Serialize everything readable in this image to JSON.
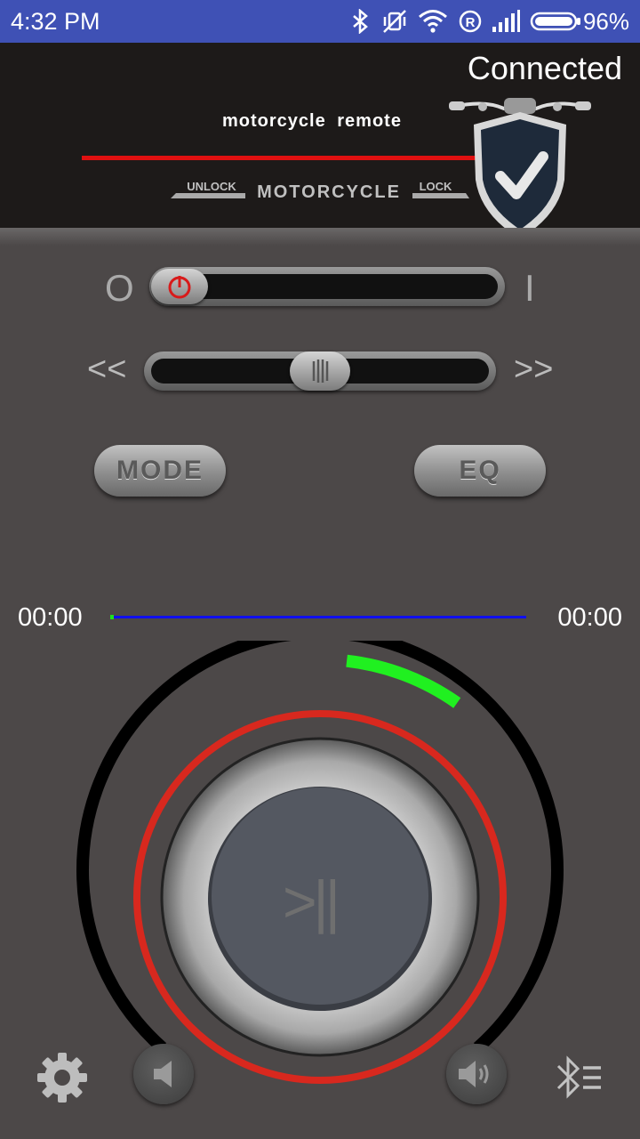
{
  "status_bar": {
    "time": "4:32 PM",
    "battery": "96%",
    "icons": [
      "bluetooth-icon",
      "vibrate-off-icon",
      "wifi-icon",
      "roaming-icon",
      "signal-icon",
      "battery-icon"
    ]
  },
  "header": {
    "connection_status": "Connected",
    "app_title": "motorcycle remote",
    "logo": {
      "left_text": "UNLOCK",
      "center_text": "MOTORCYCLE",
      "right_text": "LOCK"
    },
    "shield_icon": "shield-check-icon"
  },
  "controls": {
    "power_switch": {
      "off_label": "O",
      "on_label": "I",
      "state": "off"
    },
    "seek_slider": {
      "prev_label": "<<",
      "next_label": ">>",
      "position": 0.5
    },
    "mode_button": "MODE",
    "eq_button": "EQ"
  },
  "playback": {
    "current_time": "00:00",
    "total_time": "00:00",
    "play_pause_label": ">||",
    "volume_level": 0.08
  },
  "bottom": {
    "settings_icon": "gear-icon",
    "volume_down_icon": "speaker-icon",
    "volume_up_icon": "speaker-loud-icon",
    "bluetooth_menu_icon": "bluetooth-list-icon"
  },
  "colors": {
    "status_bar": "#3f51b5",
    "header_bg": "#1d1a19",
    "body_bg": "#4c4848",
    "accent_red": "#e01010",
    "progress_blue": "#1010ee",
    "volume_green": "#20f020"
  }
}
